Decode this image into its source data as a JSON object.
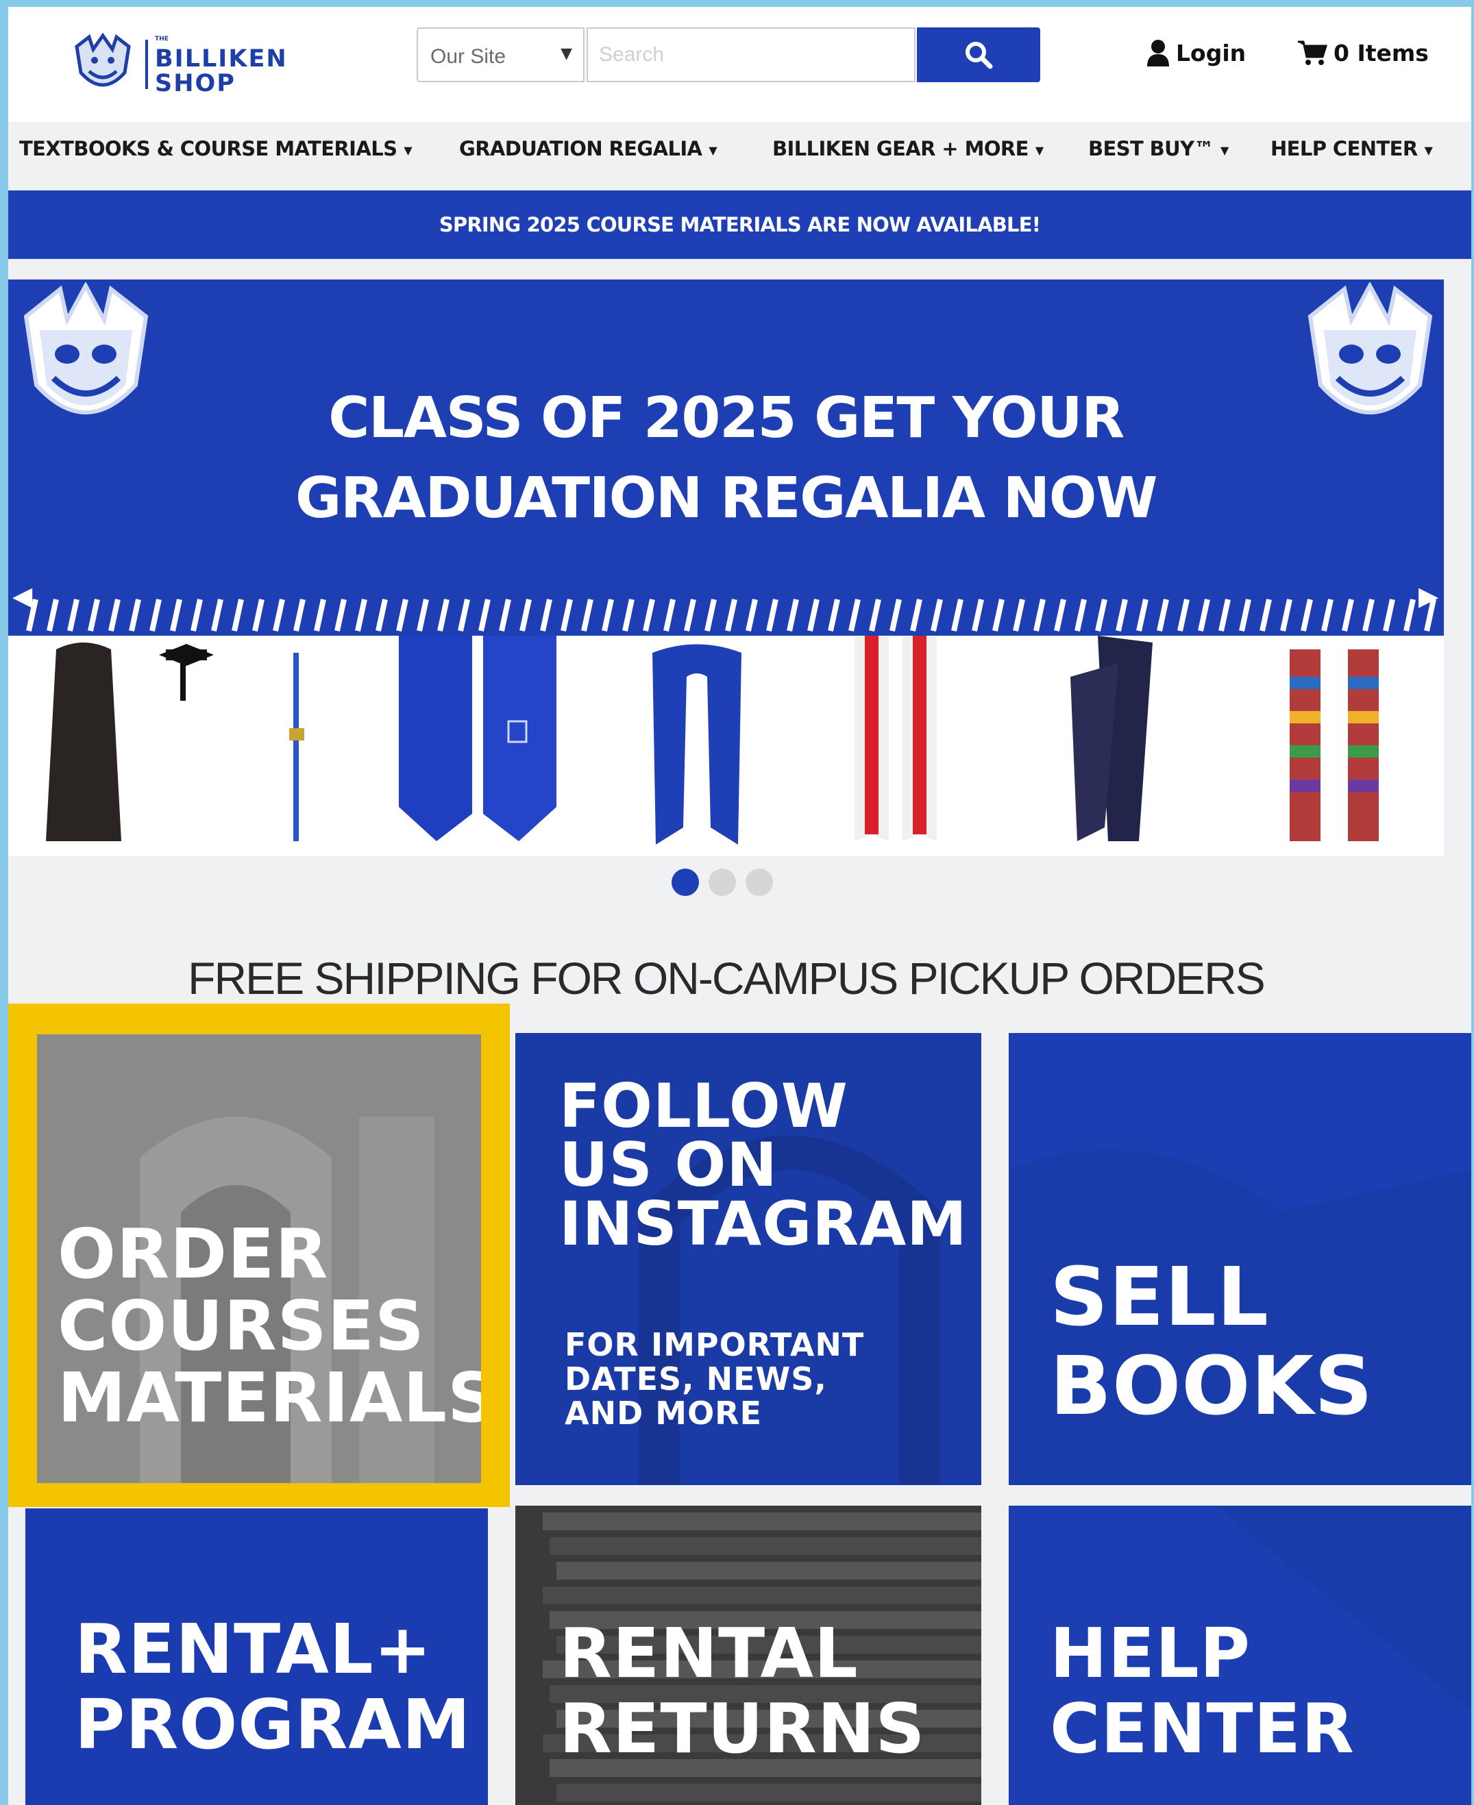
{
  "header": {
    "logo": {
      "tag": "THE",
      "line1": "BILLIKEN",
      "line2": "SHOP"
    },
    "search": {
      "scope_value": "Our Site",
      "placeholder": "Search"
    },
    "login_label": "Login",
    "cart_label": "0 Items"
  },
  "nav": {
    "items": [
      {
        "label": "TEXTBOOKS & COURSE MATERIALS"
      },
      {
        "label": "GRADUATION REGALIA"
      },
      {
        "label": "BILLIKEN GEAR + MORE"
      },
      {
        "label": "BEST BUY™"
      },
      {
        "label": "HELP CENTER"
      }
    ]
  },
  "announcement": "SPRING 2025 COURSE MATERIALS ARE NOW AVAILABLE!",
  "hero": {
    "headline_line1": "CLASS OF 2025 GET YOUR",
    "headline_line2": "GRADUATION REGALIA NOW",
    "slide_count": 3,
    "active_slide": 1,
    "products": [
      "gown-and-cap",
      "tassel",
      "blue-satin-stole",
      "blue-embroidered-stole",
      "red-white-stole",
      "navy-stole",
      "serape-stole"
    ]
  },
  "free_shipping": "FREE SHIPPING FOR ON-CAMPUS PICKUP ORDERS",
  "tiles": {
    "order": {
      "line1": "ORDER",
      "line2": "COURSES",
      "line3": "MATERIALS"
    },
    "instagram": {
      "line1": "FOLLOW",
      "line2": "US ON",
      "line3": "INSTAGRAM",
      "sub1": "FOR IMPORTANT",
      "sub2": "DATES, NEWS,",
      "sub3": "AND MORE"
    },
    "sell": {
      "line1": "SELL",
      "line2": "BOOKS"
    },
    "rental_program": {
      "line1": "RENTAL+",
      "line2": "PROGRAM"
    },
    "rental_returns": {
      "line1": "RENTAL",
      "line2": "RETURNS"
    },
    "help": {
      "line1": "HELP",
      "line2": "CENTER"
    }
  },
  "colors": {
    "brand_blue": "#1f3fb6",
    "highlight": "#f5c400"
  }
}
